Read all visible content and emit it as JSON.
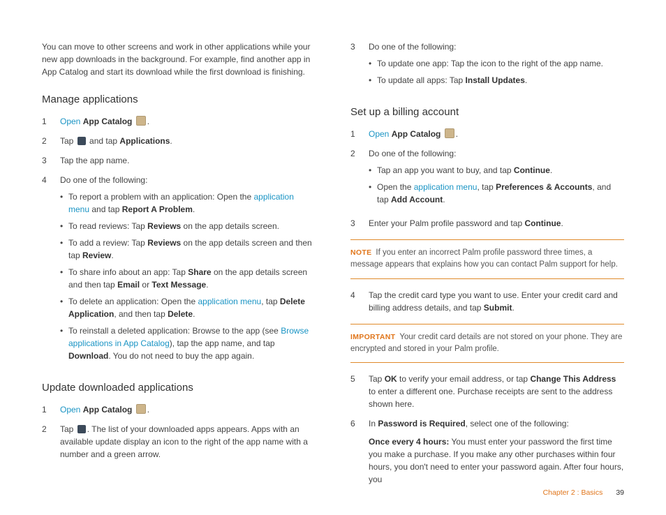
{
  "left": {
    "intro": "You can move to other screens and work in other applications while your new app downloads in the background. For example, find another app in App Catalog and start its download while the first download is finishing.",
    "section_manage": "Manage applications",
    "m1_open": "Open",
    "m1_app": "App Catalog",
    "m1_suffix": ".",
    "m2_a": "Tap ",
    "m2_b": " and tap ",
    "m2_apps": "Applications",
    "m2_c": ".",
    "m3": "Tap the app name.",
    "m4": "Do one of the following:",
    "m4b1_a": "To report a problem with an application: Open the ",
    "m4b1_link": "application menu",
    "m4b1_b": " and tap ",
    "m4b1_bold": "Report A Problem",
    "m4b1_c": ".",
    "m4b2_a": "To read reviews: Tap ",
    "m4b2_bold": "Reviews",
    "m4b2_b": " on the app details screen.",
    "m4b3_a": "To add a review: Tap ",
    "m4b3_bold1": "Reviews",
    "m4b3_b": " on the app details screen and then tap ",
    "m4b3_bold2": "Review",
    "m4b3_c": ".",
    "m4b4_a": "To share info about an app: Tap ",
    "m4b4_bold1": "Share",
    "m4b4_b": " on the app details screen and then tap ",
    "m4b4_bold2": "Email",
    "m4b4_c": " or ",
    "m4b4_bold3": "Text Message",
    "m4b4_d": ".",
    "m4b5_a": "To delete an application: Open the ",
    "m4b5_link": "application menu",
    "m4b5_b": ", tap ",
    "m4b5_bold1": "Delete Application",
    "m4b5_c": ", and then tap ",
    "m4b5_bold2": "Delete",
    "m4b5_d": ".",
    "m4b6_a": "To reinstall a deleted application: Browse to the app (see ",
    "m4b6_link": "Browse applications in App Catalog",
    "m4b6_b": "), tap the app name, and tap ",
    "m4b6_bold": "Download",
    "m4b6_c": ". You do not need to buy the app again.",
    "section_update": "Update downloaded applications",
    "u1_open": "Open",
    "u1_app": "App Catalog",
    "u1_suffix": ".",
    "u2_a": "Tap ",
    "u2_b": ". The list of your downloaded apps appears. Apps with an available update display an icon to the right of the app name with a number and a green arrow."
  },
  "right": {
    "r3": "Do one of the following:",
    "r3b1": "To update one app: Tap the icon to the right of the app name.",
    "r3b2_a": "To update all apps: Tap ",
    "r3b2_bold": "Install Updates",
    "r3b2_b": ".",
    "section_billing": "Set up a billing account",
    "b1_open": "Open",
    "b1_app": "App Catalog",
    "b1_suffix": ".",
    "b2": "Do one of the following:",
    "b2b1_a": "Tap an app you want to buy, and tap ",
    "b2b1_bold": "Continue",
    "b2b1_b": ".",
    "b2b2_a": "Open the ",
    "b2b2_link": "application menu",
    "b2b2_b": ", tap ",
    "b2b2_bold1": "Preferences & Accounts",
    "b2b2_c": ", and tap ",
    "b2b2_bold2": "Add Account",
    "b2b2_d": ".",
    "b3_a": "Enter your Palm profile password and tap ",
    "b3_bold": "Continue",
    "b3_b": ".",
    "note_label": "NOTE",
    "note_text": "If you enter an incorrect Palm profile password three times, a message appears that explains how you can contact Palm support for help.",
    "b4_a": "Tap the credit card type you want to use. Enter your credit card and billing address details, and tap ",
    "b4_bold": "Submit",
    "b4_b": ".",
    "imp_label": "IMPORTANT",
    "imp_text": "Your credit card details are not stored on your phone. They are encrypted and stored in your Palm profile.",
    "b5_a": "Tap ",
    "b5_bold1": "OK",
    "b5_b": " to verify your email address, or tap ",
    "b5_bold2": "Change This Address",
    "b5_c": " to enter a different one. Purchase receipts are sent to the address shown here.",
    "b6_a": "In ",
    "b6_bold": "Password is Required",
    "b6_b": ", select one of the following:",
    "b6_p_bold": "Once every 4 hours:",
    "b6_p": " You must enter your password the first time you make a purchase. If you make any other purchases within four hours, you don't need to enter your password again. After four hours, you"
  },
  "footer": {
    "chapter": "Chapter 2 : Basics",
    "page": "39"
  }
}
